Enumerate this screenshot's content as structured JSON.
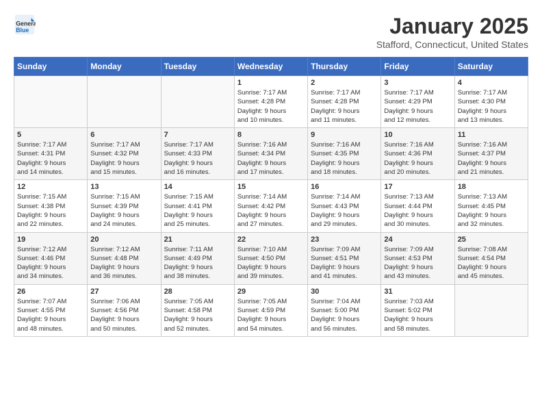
{
  "header": {
    "logo_general": "General",
    "logo_blue": "Blue",
    "month_title": "January 2025",
    "location": "Stafford, Connecticut, United States"
  },
  "days_of_week": [
    "Sunday",
    "Monday",
    "Tuesday",
    "Wednesday",
    "Thursday",
    "Friday",
    "Saturday"
  ],
  "weeks": [
    [
      {
        "day": "",
        "content": ""
      },
      {
        "day": "",
        "content": ""
      },
      {
        "day": "",
        "content": ""
      },
      {
        "day": "1",
        "content": "Sunrise: 7:17 AM\nSunset: 4:28 PM\nDaylight: 9 hours\nand 10 minutes."
      },
      {
        "day": "2",
        "content": "Sunrise: 7:17 AM\nSunset: 4:28 PM\nDaylight: 9 hours\nand 11 minutes."
      },
      {
        "day": "3",
        "content": "Sunrise: 7:17 AM\nSunset: 4:29 PM\nDaylight: 9 hours\nand 12 minutes."
      },
      {
        "day": "4",
        "content": "Sunrise: 7:17 AM\nSunset: 4:30 PM\nDaylight: 9 hours\nand 13 minutes."
      }
    ],
    [
      {
        "day": "5",
        "content": "Sunrise: 7:17 AM\nSunset: 4:31 PM\nDaylight: 9 hours\nand 14 minutes."
      },
      {
        "day": "6",
        "content": "Sunrise: 7:17 AM\nSunset: 4:32 PM\nDaylight: 9 hours\nand 15 minutes."
      },
      {
        "day": "7",
        "content": "Sunrise: 7:17 AM\nSunset: 4:33 PM\nDaylight: 9 hours\nand 16 minutes."
      },
      {
        "day": "8",
        "content": "Sunrise: 7:16 AM\nSunset: 4:34 PM\nDaylight: 9 hours\nand 17 minutes."
      },
      {
        "day": "9",
        "content": "Sunrise: 7:16 AM\nSunset: 4:35 PM\nDaylight: 9 hours\nand 18 minutes."
      },
      {
        "day": "10",
        "content": "Sunrise: 7:16 AM\nSunset: 4:36 PM\nDaylight: 9 hours\nand 20 minutes."
      },
      {
        "day": "11",
        "content": "Sunrise: 7:16 AM\nSunset: 4:37 PM\nDaylight: 9 hours\nand 21 minutes."
      }
    ],
    [
      {
        "day": "12",
        "content": "Sunrise: 7:15 AM\nSunset: 4:38 PM\nDaylight: 9 hours\nand 22 minutes."
      },
      {
        "day": "13",
        "content": "Sunrise: 7:15 AM\nSunset: 4:39 PM\nDaylight: 9 hours\nand 24 minutes."
      },
      {
        "day": "14",
        "content": "Sunrise: 7:15 AM\nSunset: 4:41 PM\nDaylight: 9 hours\nand 25 minutes."
      },
      {
        "day": "15",
        "content": "Sunrise: 7:14 AM\nSunset: 4:42 PM\nDaylight: 9 hours\nand 27 minutes."
      },
      {
        "day": "16",
        "content": "Sunrise: 7:14 AM\nSunset: 4:43 PM\nDaylight: 9 hours\nand 29 minutes."
      },
      {
        "day": "17",
        "content": "Sunrise: 7:13 AM\nSunset: 4:44 PM\nDaylight: 9 hours\nand 30 minutes."
      },
      {
        "day": "18",
        "content": "Sunrise: 7:13 AM\nSunset: 4:45 PM\nDaylight: 9 hours\nand 32 minutes."
      }
    ],
    [
      {
        "day": "19",
        "content": "Sunrise: 7:12 AM\nSunset: 4:46 PM\nDaylight: 9 hours\nand 34 minutes."
      },
      {
        "day": "20",
        "content": "Sunrise: 7:12 AM\nSunset: 4:48 PM\nDaylight: 9 hours\nand 36 minutes."
      },
      {
        "day": "21",
        "content": "Sunrise: 7:11 AM\nSunset: 4:49 PM\nDaylight: 9 hours\nand 38 minutes."
      },
      {
        "day": "22",
        "content": "Sunrise: 7:10 AM\nSunset: 4:50 PM\nDaylight: 9 hours\nand 39 minutes."
      },
      {
        "day": "23",
        "content": "Sunrise: 7:09 AM\nSunset: 4:51 PM\nDaylight: 9 hours\nand 41 minutes."
      },
      {
        "day": "24",
        "content": "Sunrise: 7:09 AM\nSunset: 4:53 PM\nDaylight: 9 hours\nand 43 minutes."
      },
      {
        "day": "25",
        "content": "Sunrise: 7:08 AM\nSunset: 4:54 PM\nDaylight: 9 hours\nand 45 minutes."
      }
    ],
    [
      {
        "day": "26",
        "content": "Sunrise: 7:07 AM\nSunset: 4:55 PM\nDaylight: 9 hours\nand 48 minutes."
      },
      {
        "day": "27",
        "content": "Sunrise: 7:06 AM\nSunset: 4:56 PM\nDaylight: 9 hours\nand 50 minutes."
      },
      {
        "day": "28",
        "content": "Sunrise: 7:05 AM\nSunset: 4:58 PM\nDaylight: 9 hours\nand 52 minutes."
      },
      {
        "day": "29",
        "content": "Sunrise: 7:05 AM\nSunset: 4:59 PM\nDaylight: 9 hours\nand 54 minutes."
      },
      {
        "day": "30",
        "content": "Sunrise: 7:04 AM\nSunset: 5:00 PM\nDaylight: 9 hours\nand 56 minutes."
      },
      {
        "day": "31",
        "content": "Sunrise: 7:03 AM\nSunset: 5:02 PM\nDaylight: 9 hours\nand 58 minutes."
      },
      {
        "day": "",
        "content": ""
      }
    ]
  ]
}
